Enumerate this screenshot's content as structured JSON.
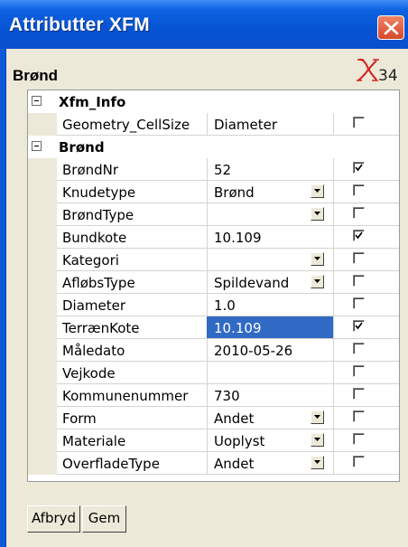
{
  "window": {
    "title": "Attributter XFM",
    "group_title": "Brønd",
    "logo_text": "34",
    "colors": {
      "titlebar": "#0553d3",
      "selection": "#316ac5",
      "client": "#ece9d8",
      "close": "#d6472b"
    }
  },
  "sections": [
    {
      "header": "Xfm_Info",
      "rows": [
        {
          "label": "Geometry_CellSize",
          "value": "Diameter",
          "dropdown": false,
          "checked": false
        }
      ]
    },
    {
      "header": "Brønd",
      "rows": [
        {
          "label": "BrøndNr",
          "value": "52",
          "dropdown": false,
          "checked": true
        },
        {
          "label": "Knudetype",
          "value": "Brønd",
          "dropdown": true,
          "checked": false
        },
        {
          "label": "BrøndType",
          "value": "",
          "dropdown": true,
          "checked": false
        },
        {
          "label": "Bundkote",
          "value": "10.109",
          "dropdown": false,
          "checked": true
        },
        {
          "label": "Kategori",
          "value": "",
          "dropdown": true,
          "checked": false
        },
        {
          "label": "AfløbsType",
          "value": "Spildevand",
          "dropdown": true,
          "checked": false
        },
        {
          "label": "Diameter",
          "value": "1.0",
          "dropdown": false,
          "checked": false
        },
        {
          "label": "TerrænKote",
          "value": "10.109",
          "dropdown": false,
          "checked": true,
          "selected": true
        },
        {
          "label": "Måledato",
          "value": "2010-05-26",
          "dropdown": false,
          "checked": false
        },
        {
          "label": "Vejkode",
          "value": "",
          "dropdown": false,
          "checked": false
        },
        {
          "label": "Kommunenummer",
          "value": "730",
          "dropdown": false,
          "checked": false
        },
        {
          "label": "Form",
          "value": "Andet",
          "dropdown": true,
          "checked": false
        },
        {
          "label": "Materiale",
          "value": "Uoplyst",
          "dropdown": true,
          "checked": false
        },
        {
          "label": "OverfladeType",
          "value": "Andet",
          "dropdown": true,
          "checked": false
        }
      ]
    }
  ],
  "buttons": {
    "abort": "Afbryd",
    "save": "Gem"
  }
}
